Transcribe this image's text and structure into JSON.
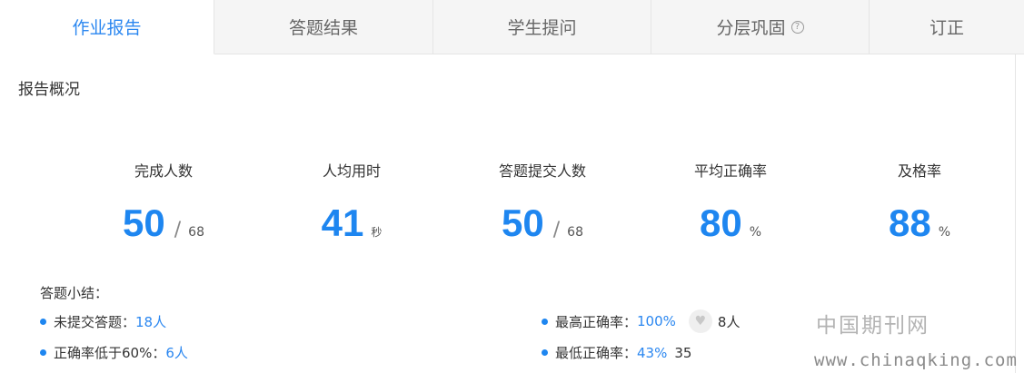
{
  "tabs": [
    {
      "label": "作业报告",
      "active": true
    },
    {
      "label": "答题结果",
      "active": false
    },
    {
      "label": "学生提问",
      "active": false
    },
    {
      "label": "分层巩固",
      "active": false,
      "icon": "help-circle-icon"
    },
    {
      "label": "订正",
      "active": false
    }
  ],
  "overview": {
    "title": "报告概况",
    "stats": [
      {
        "label": "完成人数",
        "value": "50",
        "sep": "/",
        "suffix": "68"
      },
      {
        "label": "人均用时",
        "value": "41",
        "suffix": "秒"
      },
      {
        "label": "答题提交人数",
        "value": "50",
        "sep": "/",
        "suffix": "68"
      },
      {
        "label": "平均正确率",
        "value": "80",
        "suffix": "%"
      },
      {
        "label": "及格率",
        "value": "88",
        "suffix": "%"
      }
    ]
  },
  "summary": {
    "title": "答题小结：",
    "not_submitted_label": "未提交答题：",
    "not_submitted_value": "18人",
    "below60_label": "正确率低于60%：",
    "below60_value": "6人",
    "highest_label": "最高正确率：",
    "highest_value": "100%",
    "highest_count": "8人",
    "lowest_label": "最低正确率：",
    "lowest_value": "43%",
    "lowest_count": "35"
  },
  "watermark": {
    "cn": "中国期刊网",
    "url": "www.chinaqking.com"
  },
  "colors": {
    "accent": "#1e86f0",
    "tab_bg": "#f5f5f5"
  }
}
